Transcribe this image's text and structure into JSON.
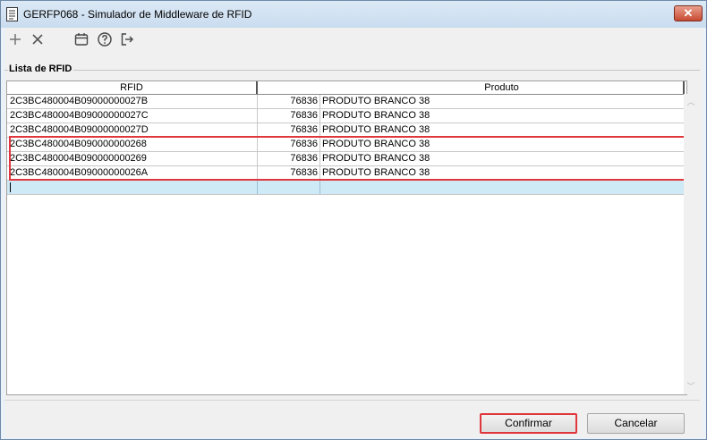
{
  "window": {
    "title": "GERFP068 - Simulador de Middleware de RFID",
    "close_label": "✕"
  },
  "toolbar": {
    "icons": [
      "plus-icon",
      "close-icon",
      "calendar-icon",
      "help-icon",
      "exit-icon"
    ]
  },
  "group": {
    "label": "Lista de RFID"
  },
  "grid": {
    "columns": [
      "RFID",
      "",
      "Produto"
    ],
    "rows": [
      {
        "rfid": "2C3BC480004B09000000027B",
        "code": "76836",
        "produto": "PRODUTO BRANCO 38"
      },
      {
        "rfid": "2C3BC480004B09000000027C",
        "code": "76836",
        "produto": "PRODUTO BRANCO 38"
      },
      {
        "rfid": "2C3BC480004B09000000027D",
        "code": "76836",
        "produto": "PRODUTO BRANCO 38"
      },
      {
        "rfid": "2C3BC480004B090000000268",
        "code": "76836",
        "produto": "PRODUTO BRANCO 38"
      },
      {
        "rfid": "2C3BC480004B090000000269",
        "code": "76836",
        "produto": "PRODUTO BRANCO 38"
      },
      {
        "rfid": "2C3BC480004B09000000026A",
        "code": "76836",
        "produto": "PRODUTO BRANCO 38"
      }
    ],
    "highlighted_rows": [
      3,
      4,
      5
    ]
  },
  "buttons": {
    "confirm_label": "Confirmar",
    "cancel_label": "Cancelar"
  },
  "colors": {
    "highlight": "#e0373d",
    "new_row": "#cfeaf7",
    "titlebar": "#c9dcef"
  }
}
